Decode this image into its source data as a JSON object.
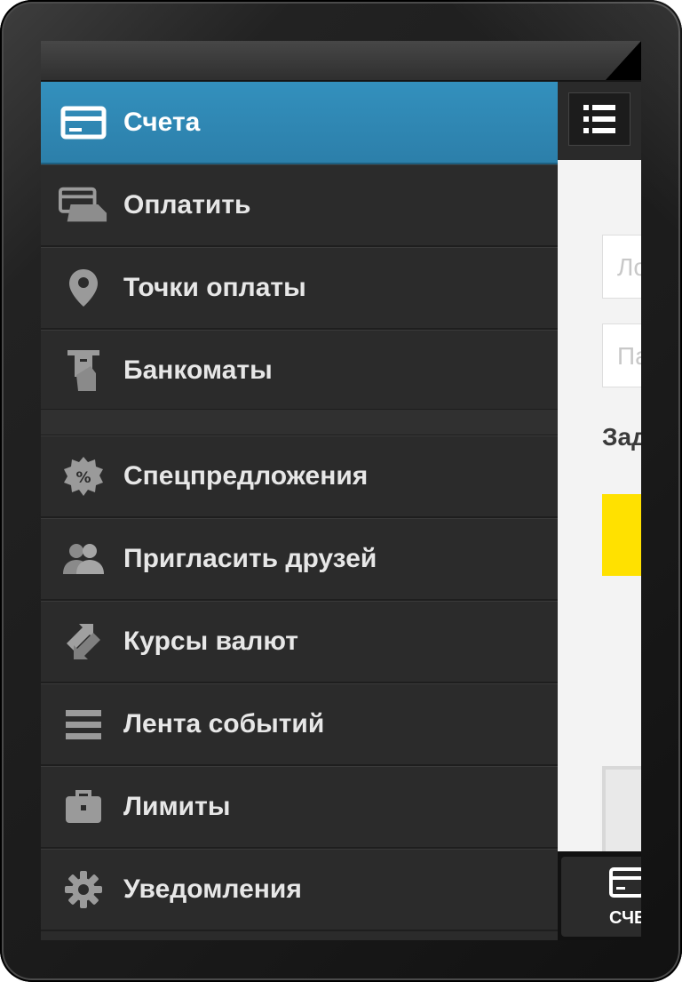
{
  "menu": {
    "items": [
      {
        "id": "accounts",
        "label": "Счета",
        "icon": "card-icon",
        "active": true
      },
      {
        "id": "pay",
        "label": "Оплатить",
        "icon": "payment-icon",
        "active": false
      },
      {
        "id": "payment-points",
        "label": "Точки оплаты",
        "icon": "location-pin-icon",
        "active": false
      },
      {
        "id": "atms",
        "label": "Банкоматы",
        "icon": "atm-icon",
        "active": false
      },
      {
        "id": "special-offers",
        "label": "Спецпредложения",
        "icon": "percent-badge-icon",
        "active": false
      },
      {
        "id": "invite-friends",
        "label": "Пригласить друзей",
        "icon": "people-icon",
        "active": false
      },
      {
        "id": "exchange-rates",
        "label": "Курсы валют",
        "icon": "exchange-arrows-icon",
        "active": false
      },
      {
        "id": "event-feed",
        "label": "Лента событий",
        "icon": "feed-lines-icon",
        "active": false
      },
      {
        "id": "limits",
        "label": "Лимиты",
        "icon": "briefcase-icon",
        "active": false
      },
      {
        "id": "notifications",
        "label": "Уведомления",
        "icon": "gear-icon",
        "active": false
      }
    ]
  },
  "content": {
    "login_placeholder": "Ло",
    "password_placeholder": "Па",
    "task_label": "Зад",
    "tab_label": "СЧЕТ"
  },
  "colors": {
    "active_item": "#2f87b3",
    "drawer_bg": "#2b2b2b",
    "accent_yellow": "#ffe100"
  }
}
